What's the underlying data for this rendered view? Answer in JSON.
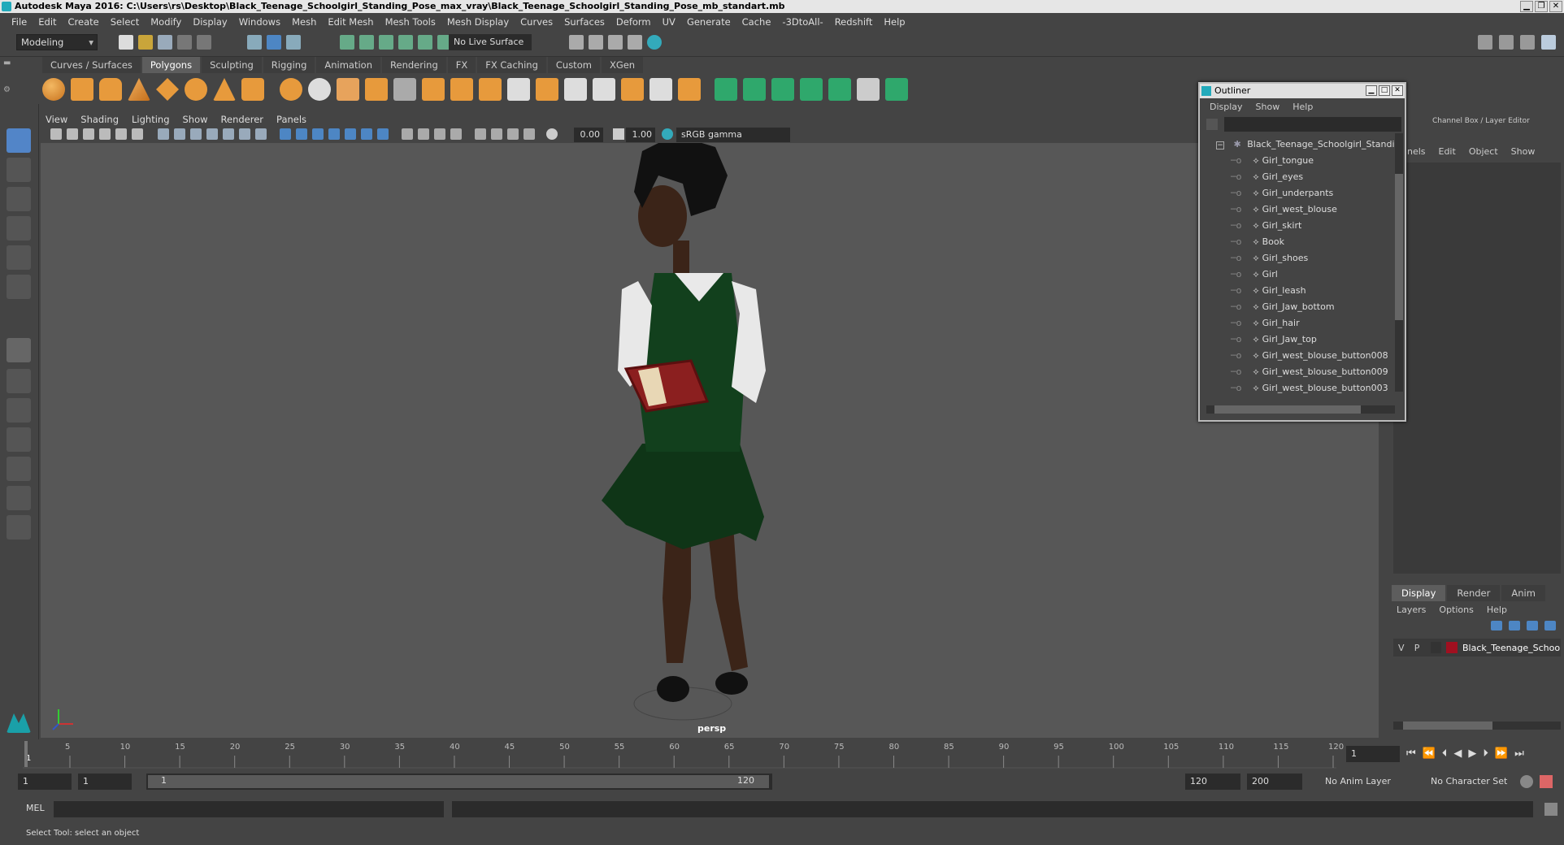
{
  "window": {
    "title": "Autodesk Maya 2016: C:\\Users\\rs\\Desktop\\Black_Teenage_Schoolgirl_Standing_Pose_max_vray\\Black_Teenage_Schoolgirl_Standing_Pose_mb_standart.mb",
    "buttons": [
      "▁",
      "❐",
      "✕"
    ]
  },
  "menubar": [
    "File",
    "Edit",
    "Create",
    "Select",
    "Modify",
    "Display",
    "Windows",
    "Mesh",
    "Edit Mesh",
    "Mesh Tools",
    "Mesh Display",
    "Curves",
    "Surfaces",
    "Deform",
    "UV",
    "Generate",
    "Cache",
    "-3DtoAll-",
    "Redshift",
    "Help"
  ],
  "status_line": {
    "mode": "Modeling",
    "live_surface": "No Live Surface"
  },
  "shelf": {
    "tabs": [
      "Curves / Surfaces",
      "Polygons",
      "Sculpting",
      "Rigging",
      "Animation",
      "Rendering",
      "FX",
      "FX Caching",
      "Custom",
      "XGen"
    ],
    "active_tab": "Polygons"
  },
  "viewport": {
    "menu": [
      "View",
      "Shading",
      "Lighting",
      "Show",
      "Renderer",
      "Panels"
    ],
    "exposure": "0.00",
    "gamma": "1.00",
    "color_space": "sRGB gamma",
    "camera_label": "persp"
  },
  "outliner": {
    "title": "Outliner",
    "menu": [
      "Display",
      "Show",
      "Help"
    ],
    "root": "Black_Teenage_Schoolgirl_Standi",
    "items": [
      "Girl_tongue",
      "Girl_eyes",
      "Girl_underpants",
      "Girl_west_blouse",
      "Girl_skirt",
      "Book",
      "Girl_shoes",
      "Girl",
      "Girl_leash",
      "Girl_Jaw_bottom",
      "Girl_hair",
      "Girl_Jaw_top",
      "Girl_west_blouse_button008",
      "Girl_west_blouse_button009",
      "Girl_west_blouse_button003"
    ]
  },
  "channel_box": {
    "title": "Channel Box / Layer Editor",
    "menu": [
      "nnels",
      "Edit",
      "Object",
      "Show"
    ]
  },
  "layer_editor": {
    "tabs": [
      "Display",
      "Render",
      "Anim"
    ],
    "active_tab": "Display",
    "menu": [
      "Layers",
      "Options",
      "Help"
    ],
    "layer": {
      "v": "V",
      "p": "P",
      "name": "Black_Teenage_School",
      "color": "#a01020"
    }
  },
  "timeline": {
    "ticks": [
      "5",
      "10",
      "15",
      "20",
      "25",
      "30",
      "35",
      "40",
      "45",
      "50",
      "55",
      "60",
      "65",
      "70",
      "75",
      "80",
      "85",
      "90",
      "95",
      "100",
      "105",
      "110",
      "115",
      "120"
    ],
    "start_label": "1",
    "current_frame": "1"
  },
  "range": {
    "start": "1",
    "playback_start": "1",
    "slider_start": "1",
    "slider_end": "120",
    "playback_end": "120",
    "end": "200",
    "anim_layer": "No Anim Layer",
    "character_set": "No Character Set"
  },
  "command_line": {
    "label": "MEL"
  },
  "help_line": {
    "text": "Select Tool: select an object"
  }
}
